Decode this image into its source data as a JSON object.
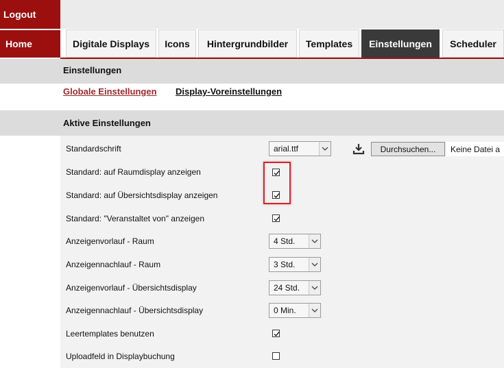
{
  "sidebar": {
    "logout_label": "Logout",
    "home_label": "Home"
  },
  "tabs": [
    {
      "label": "Digitale Displays"
    },
    {
      "label": "Icons"
    },
    {
      "label": "Hintergrundbilder"
    },
    {
      "label": "Templates"
    },
    {
      "label": "Einstellungen",
      "active": true
    },
    {
      "label": "Scheduler"
    }
  ],
  "section": {
    "title": "Einstellungen",
    "subnav": [
      {
        "label": "Globale Einstellungen",
        "active": true
      },
      {
        "label": "Display-Voreinstellungen"
      }
    ]
  },
  "active_settings": {
    "title": "Aktive Einstellungen",
    "font_row": {
      "label": "Standardschrift",
      "select_value": "arial.ttf",
      "upload_button": "Durchsuchen...",
      "file_status": "Keine Datei a"
    },
    "rows": [
      {
        "label": "Standard: auf Raumdisplay anzeigen",
        "type": "checkbox",
        "checked": true
      },
      {
        "label": "Standard: auf Übersichtsdisplay anzeigen",
        "type": "checkbox",
        "checked": true
      },
      {
        "label": "Standard: \"Veranstaltet von\" anzeigen",
        "type": "checkbox",
        "checked": true
      },
      {
        "label": "Anzeigenvorlauf - Raum",
        "type": "select",
        "value": "4 Std."
      },
      {
        "label": "Anzeigennachlauf - Raum",
        "type": "select",
        "value": "3 Std."
      },
      {
        "label": "Anzeigenvorlauf - Übersichtsdisplay",
        "type": "select",
        "value": "24 Std."
      },
      {
        "label": "Anzeigennachlauf - Übersichtsdisplay",
        "type": "select",
        "value": "0 Min."
      },
      {
        "label": "Leertemplates benutzen",
        "type": "checkbox",
        "checked": true
      },
      {
        "label": "Uploadfeld in Displaybuchung",
        "type": "checkbox",
        "checked": false
      }
    ]
  },
  "colors": {
    "brand_red": "#9b0f0f",
    "active_tab": "#3a3a3a",
    "highlight": "#d9232b",
    "link_active": "#9b2a2a"
  }
}
